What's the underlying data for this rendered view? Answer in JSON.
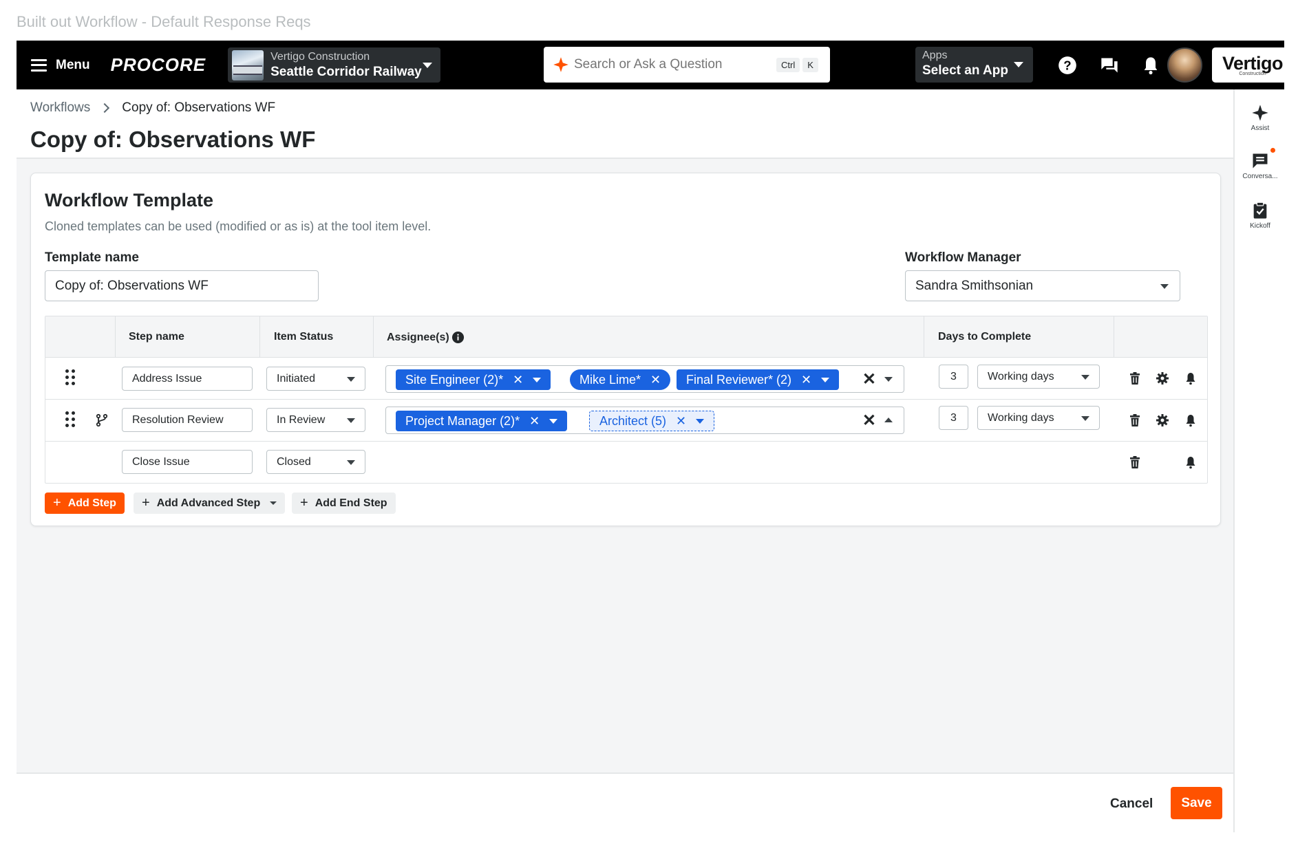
{
  "frame_title": "Built out Workflow - Default Response Reqs",
  "topnav": {
    "menu_label": "Menu",
    "logo": "PROCORE",
    "project": {
      "company": "Vertigo Construction",
      "name": "Seattle Corridor Railway"
    },
    "search": {
      "placeholder": "Search or Ask a Question",
      "shortcut_1": "Ctrl",
      "shortcut_2": "K"
    },
    "apps": {
      "label": "Apps",
      "value": "Select an App"
    },
    "brand": {
      "name": "Vertigo",
      "sub": "Construction"
    },
    "icons": [
      "help-icon",
      "chat-icon",
      "bell-icon"
    ]
  },
  "breadcrumb": {
    "parent": "Workflows",
    "current": "Copy of: Observations WF"
  },
  "page_title": "Copy of: Observations WF",
  "card": {
    "title": "Workflow Template",
    "subtitle": "Cloned templates can be used (modified or as is) at the tool item level.",
    "template_name_label": "Template name",
    "template_name_value": "Copy of: Observations WF",
    "manager_label": "Workflow Manager",
    "manager_value": "Sandra Smithsonian"
  },
  "table": {
    "headers": {
      "step": "Step name",
      "status": "Item Status",
      "assignees": "Assignee(s)",
      "days": "Days to Complete"
    },
    "rows": [
      {
        "step": "Address Issue",
        "status": "Initiated",
        "assignees": [
          "Site Engineer (2)*",
          "Mike Lime*",
          "Final Reviewer* (2)"
        ],
        "days": "3",
        "day_type": "Working days"
      },
      {
        "step": "Resolution Review",
        "status": "In Review",
        "assignees": [
          "Project Manager (2)*",
          "Architect (5)"
        ],
        "days": "3",
        "day_type": "Working days"
      },
      {
        "step": "Close Issue",
        "status": "Closed"
      }
    ]
  },
  "buttons": {
    "add_step": "Add Step",
    "add_advanced_step": "Add Advanced Step",
    "add_end_step": "Add End Step"
  },
  "rail": {
    "assist": "Assist",
    "conversations": "Conversa...",
    "kickoff": "Kickoff"
  },
  "footer": {
    "cancel": "Cancel",
    "save": "Save"
  },
  "colors": {
    "accent": "#ff5200",
    "chip": "#1a63e0",
    "nav": "#000000"
  }
}
